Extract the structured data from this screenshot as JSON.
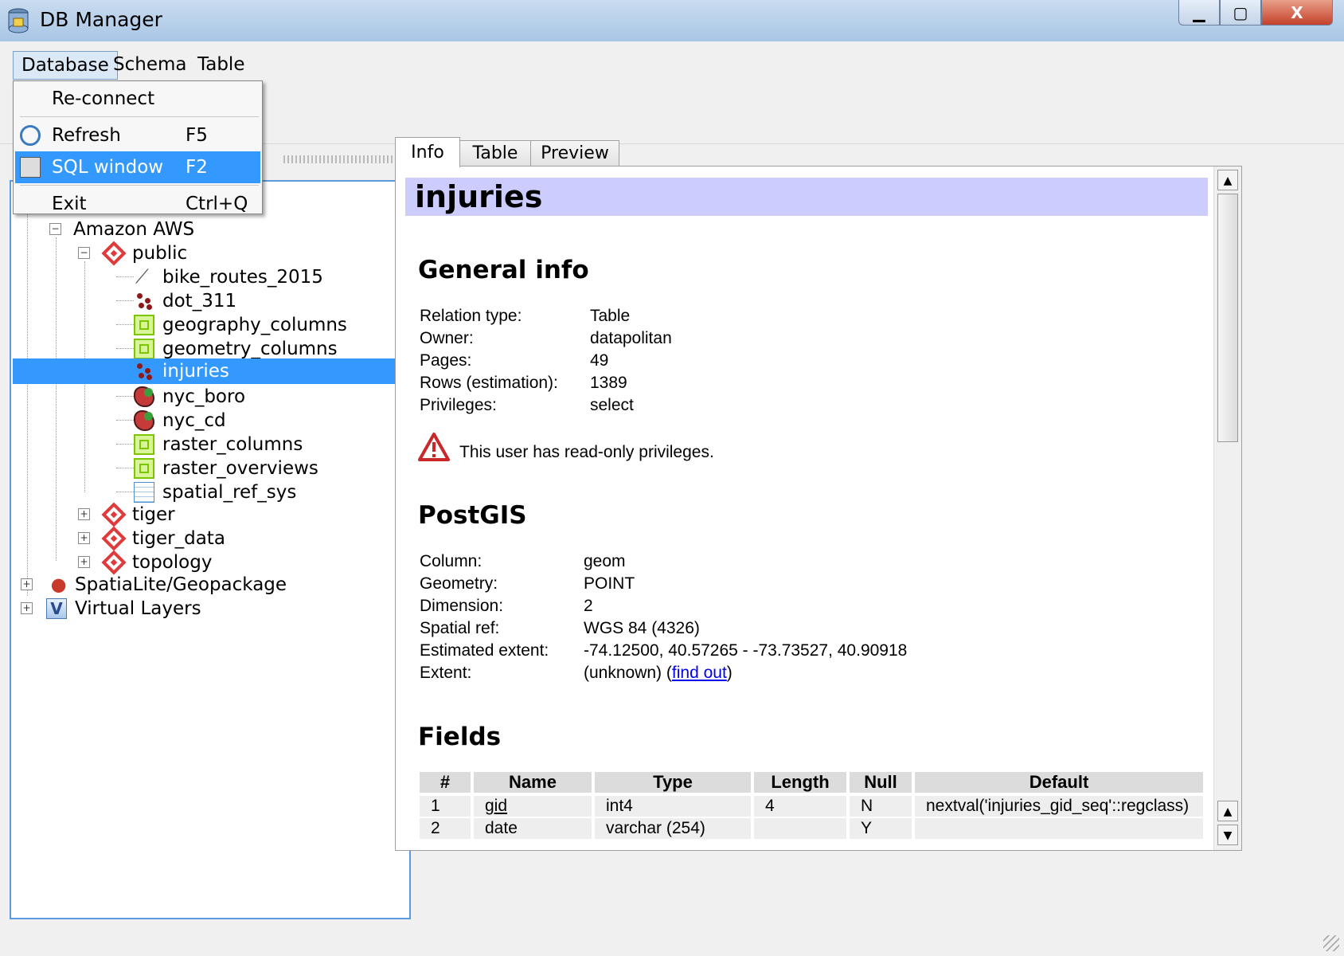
{
  "window": {
    "title": "DB Manager",
    "minimize": "▁",
    "maximize": "▢",
    "close": "X"
  },
  "menubar": {
    "database": "Database",
    "schema": "Schema",
    "table": "Table"
  },
  "database_menu": {
    "items": [
      {
        "label": "Re-connect",
        "shortcut": ""
      },
      {
        "label": "Refresh",
        "shortcut": "F5"
      },
      {
        "label": "SQL window",
        "shortcut": "F2"
      },
      {
        "label": "Exit",
        "shortcut": "Ctrl+Q"
      }
    ]
  },
  "tree": {
    "connection": "Amazon AWS",
    "schema_public": "public",
    "tables": [
      "bike_routes_2015",
      "dot_311",
      "geography_columns",
      "geometry_columns",
      "injuries",
      "nyc_boro",
      "nyc_cd",
      "raster_columns",
      "raster_overviews",
      "spatial_ref_sys"
    ],
    "selected": "injuries",
    "schemas_other": [
      "tiger",
      "tiger_data",
      "topology"
    ],
    "providers": [
      "SpatiaLite/Geopackage",
      "Virtual Layers"
    ]
  },
  "tabs": [
    "Info",
    "Table",
    "Preview"
  ],
  "info": {
    "title": "injuries",
    "general_heading": "General info",
    "general": [
      {
        "k": "Relation type:",
        "v": "Table"
      },
      {
        "k": "Owner:",
        "v": "datapolitan"
      },
      {
        "k": "Pages:",
        "v": "49"
      },
      {
        "k": "Rows (estimation):",
        "v": "1389"
      },
      {
        "k": "Privileges:",
        "v": "select"
      }
    ],
    "warning": "This user has read-only privileges.",
    "postgis_heading": "PostGIS",
    "postgis": [
      {
        "k": "Column:",
        "v": "geom"
      },
      {
        "k": "Geometry:",
        "v": "POINT"
      },
      {
        "k": "Dimension:",
        "v": "2"
      },
      {
        "k": "Spatial ref:",
        "v": "WGS 84 (4326)"
      },
      {
        "k": "Estimated extent:",
        "v": "-74.12500, 40.57265 - -73.73527, 40.90918"
      }
    ],
    "extent_label": "Extent:",
    "extent_value": "(unknown) (",
    "extent_link": "find out",
    "extent_close": ")",
    "fields_heading": "Fields",
    "fields_columns": [
      "#",
      "Name",
      "Type",
      "Length",
      "Null",
      "Default"
    ],
    "fields_rows": [
      [
        "1",
        "gid",
        "int4",
        "4",
        "N",
        "nextval('injuries_gid_seq'::regclass)"
      ],
      [
        "2",
        "date",
        "varchar (254)",
        "",
        "Y",
        ""
      ]
    ]
  },
  "colors": {
    "selection": "#3399ff",
    "title_band": "#ccccff",
    "accent_border": "#5a9ae0"
  }
}
